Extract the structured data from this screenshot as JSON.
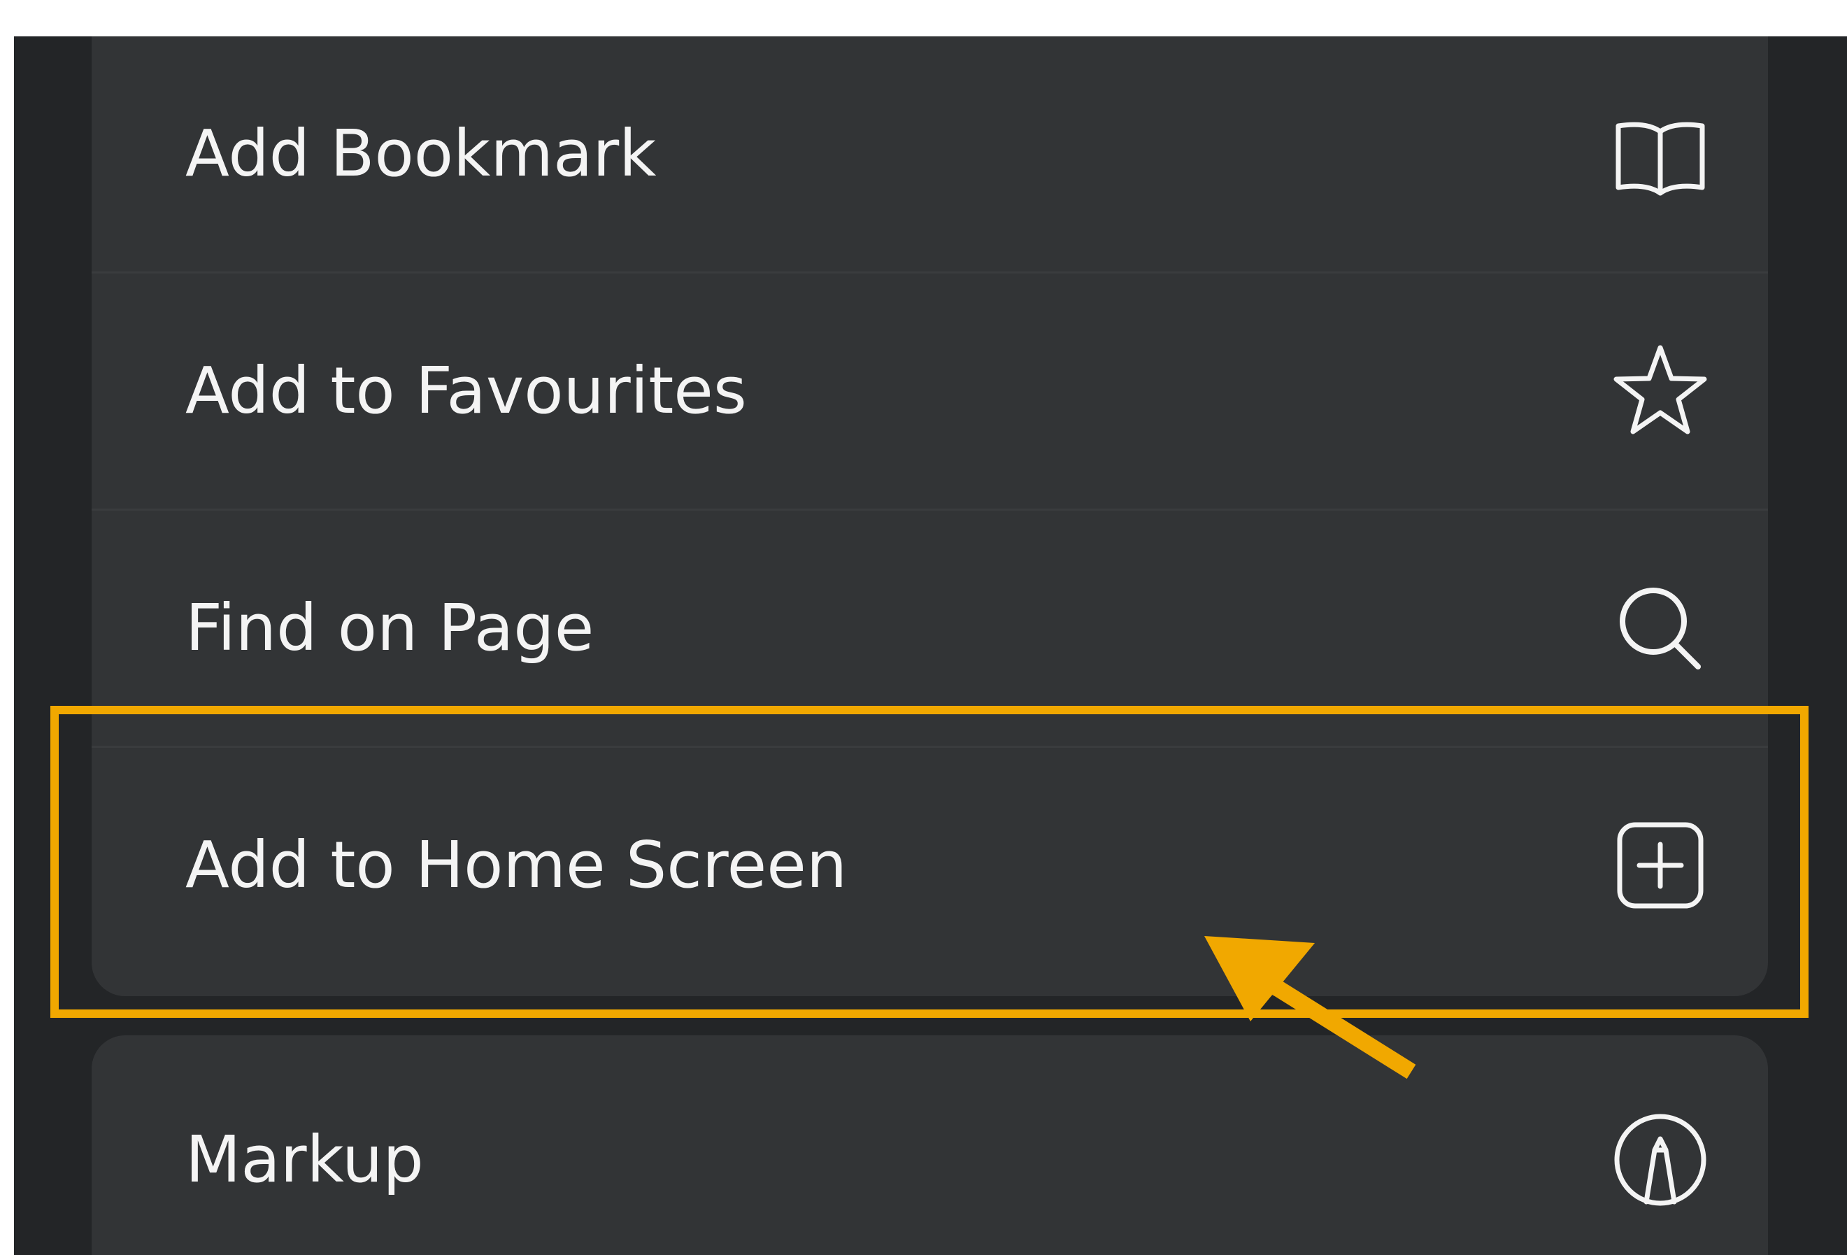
{
  "menu": {
    "items": [
      {
        "label": "Add Bookmark",
        "icon": "book-icon"
      },
      {
        "label": "Add to Favourites",
        "icon": "star-icon"
      },
      {
        "label": "Find on Page",
        "icon": "search-icon"
      },
      {
        "label": "Add to Home Screen",
        "icon": "plus-square-icon"
      },
      {
        "label": "Markup",
        "icon": "markup-pen-icon"
      }
    ]
  },
  "annotation": {
    "highlight_color": "#f1a800",
    "highlighted_item": "Add to Home Screen"
  },
  "colors": {
    "background": "#232527",
    "group_background": "#323436",
    "text": "#f4f4f4"
  }
}
